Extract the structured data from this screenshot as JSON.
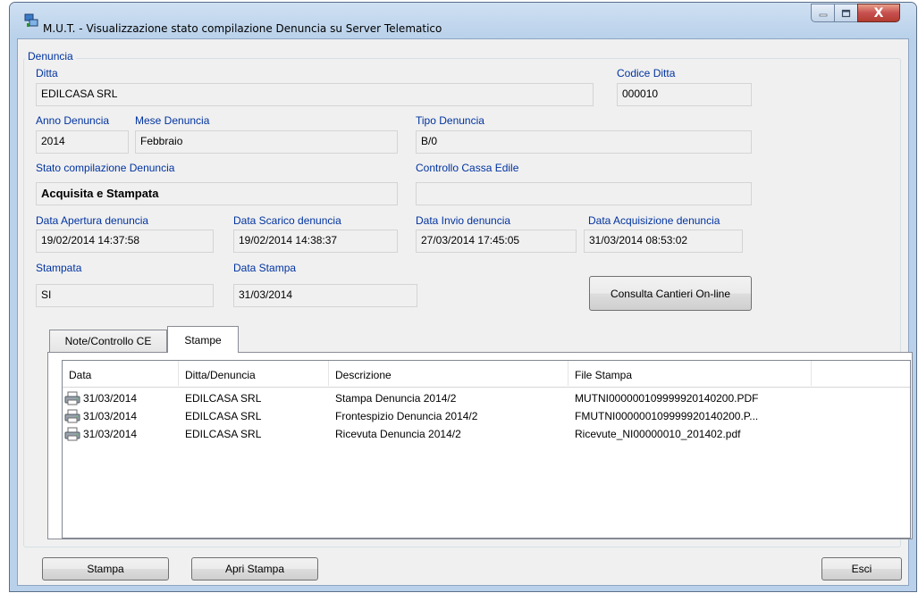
{
  "window": {
    "title": "M.U.T. - Visualizzazione stato compilazione Denuncia su Server Telematico",
    "icon": "app-network-icon",
    "controls": {
      "minimize": "minimize-icon",
      "maximize": "maximize-icon",
      "close": "X"
    }
  },
  "group": {
    "legend": "Denuncia"
  },
  "fields": {
    "ditta": {
      "label": "Ditta",
      "value": "EDILCASA SRL"
    },
    "codice_ditta": {
      "label": "Codice Ditta",
      "value": "000010"
    },
    "anno": {
      "label": "Anno Denuncia",
      "value": "2014"
    },
    "mese": {
      "label": "Mese Denuncia",
      "value": "Febbraio"
    },
    "tipo": {
      "label": "Tipo Denuncia",
      "value": "B/0"
    },
    "stato": {
      "label": "Stato compilazione Denuncia",
      "value": "Acquisita e Stampata"
    },
    "controllo": {
      "label": "Controllo Cassa Edile",
      "value": ""
    },
    "apertura": {
      "label": "Data Apertura denuncia",
      "value": "19/02/2014 14:37:58"
    },
    "scarico": {
      "label": "Data Scarico denuncia",
      "value": "19/02/2014 14:38:37"
    },
    "invio": {
      "label": "Data Invio denuncia",
      "value": "27/03/2014 17:45:05"
    },
    "acquisizione": {
      "label": "Data Acquisizione denuncia",
      "value": "31/03/2014 08:53:02"
    },
    "stampata": {
      "label": "Stampata",
      "value": "SI"
    },
    "data_stampa": {
      "label": "Data Stampa",
      "value": "31/03/2014"
    }
  },
  "buttons": {
    "consulta": "Consulta Cantieri On-line",
    "stampa": "Stampa",
    "apri_stampa": "Apri Stampa",
    "esci": "Esci"
  },
  "tabs": [
    {
      "label": "Note/Controllo CE",
      "selected": false
    },
    {
      "label": "Stampe",
      "selected": true
    }
  ],
  "list": {
    "columns": [
      "Data",
      "Ditta/Denuncia",
      "Descrizione",
      "File Stampa"
    ],
    "row_icon": "printer-icon",
    "rows": [
      {
        "data": "31/03/2014",
        "ditta": "EDILCASA SRL",
        "descrizione": "Stampa Denuncia 2014/2",
        "file": "MUTNI000000109999920140200.PDF"
      },
      {
        "data": "31/03/2014",
        "ditta": "EDILCASA SRL",
        "descrizione": "Frontespizio Denuncia 2014/2",
        "file": "FMUTNI000000109999920140200.P..."
      },
      {
        "data": "31/03/2014",
        "ditta": "EDILCASA SRL",
        "descrizione": "Ricevuta Denuncia 2014/2",
        "file": "Ricevute_NI00000010_201402.pdf"
      }
    ]
  },
  "colors": {
    "label": "#0033a0",
    "window_frame": "#b9d1ea",
    "client": "#f0f0f0"
  }
}
